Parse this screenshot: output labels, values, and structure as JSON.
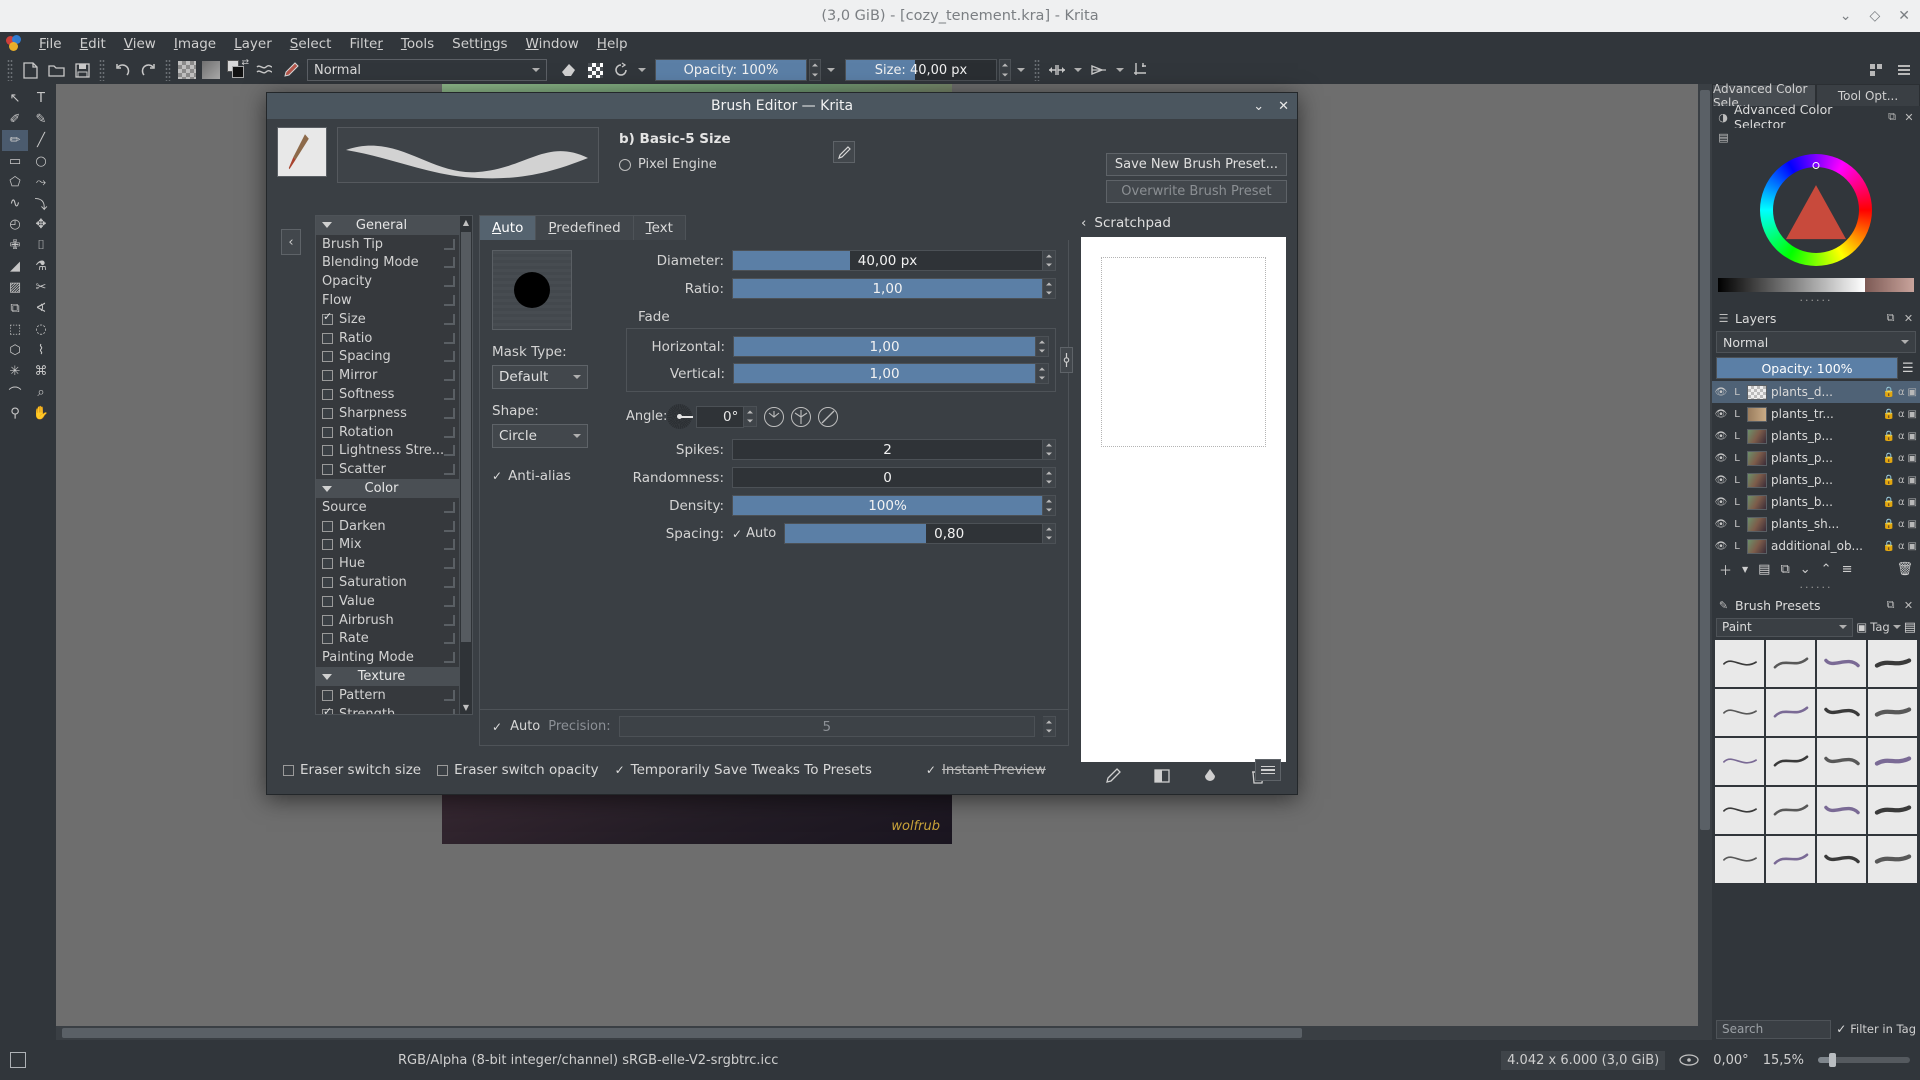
{
  "window": {
    "title": "(3,0 GiB) - [cozy_tenement.kra] - Krita",
    "minimize": "⌄",
    "maximize": "◇",
    "close": "✕"
  },
  "menubar": {
    "items": [
      {
        "label": "File",
        "accel": "F"
      },
      {
        "label": "Edit",
        "accel": "E"
      },
      {
        "label": "View",
        "accel": "V"
      },
      {
        "label": "Image",
        "accel": "I"
      },
      {
        "label": "Layer",
        "accel": "L"
      },
      {
        "label": "Select",
        "accel": "S"
      },
      {
        "label": "Filter",
        "accel": "r"
      },
      {
        "label": "Tools",
        "accel": "T"
      },
      {
        "label": "Settings",
        "accel": "n"
      },
      {
        "label": "Window",
        "accel": "W"
      },
      {
        "label": "Help",
        "accel": "H"
      }
    ]
  },
  "toolbar": {
    "blending_mode": "Normal",
    "opacity_label": "Opacity: 100%",
    "opacity_percent": 100,
    "size_label": "Size: 40,00 px",
    "size_value": "40,00 px",
    "icons": [
      "new-document-icon",
      "open-document-icon",
      "save-icon",
      "undo-icon",
      "redo-icon",
      "alpha-checker-icon",
      "gradient-swatch-icon",
      "fg-bg-color-icon",
      "brush-preset-history-icon",
      "brush-editor-icon",
      "eraser-icon",
      "preserve-alpha-icon",
      "reload-preset-icon",
      "mirror-horizontal-icon",
      "mirror-vertical-icon",
      "wrap-around-icon"
    ]
  },
  "toolbox": {
    "tools": [
      {
        "name": "shape-select-tool",
        "glyph": "↖"
      },
      {
        "name": "text-tool",
        "glyph": "T"
      },
      {
        "name": "edit-shapes-tool",
        "glyph": "✐"
      },
      {
        "name": "calligraphy-tool",
        "glyph": "✎"
      },
      {
        "name": "freehand-brush-tool",
        "glyph": "✏",
        "active": true
      },
      {
        "name": "line-tool",
        "glyph": "╱"
      },
      {
        "name": "rectangle-tool",
        "glyph": "▭"
      },
      {
        "name": "ellipse-tool",
        "glyph": "○"
      },
      {
        "name": "polygon-tool",
        "glyph": "⬠"
      },
      {
        "name": "polyline-tool",
        "glyph": "⤳"
      },
      {
        "name": "bezier-curve-tool",
        "glyph": "∿"
      },
      {
        "name": "freehand-path-tool",
        "glyph": "⤵"
      },
      {
        "name": "dynamic-brush-tool",
        "glyph": "◴"
      },
      {
        "name": "transform-tool",
        "glyph": "✥"
      },
      {
        "name": "move-tool",
        "glyph": "✙"
      },
      {
        "name": "crop-tool",
        "glyph": "⌷"
      },
      {
        "name": "fill-tool",
        "glyph": "◢"
      },
      {
        "name": "color-picker-tool",
        "glyph": "⚗"
      },
      {
        "name": "gradient-tool",
        "glyph": "▨"
      },
      {
        "name": "smart-patch-tool",
        "glyph": "✂"
      },
      {
        "name": "assistant-tool",
        "glyph": "⧉"
      },
      {
        "name": "measure-tool",
        "glyph": "∢"
      },
      {
        "name": "rect-select-tool",
        "glyph": "⬚"
      },
      {
        "name": "ellipse-select-tool",
        "glyph": "◌"
      },
      {
        "name": "polygon-select-tool",
        "glyph": "⬡"
      },
      {
        "name": "freehand-select-tool",
        "glyph": "⌇"
      },
      {
        "name": "contiguous-select-tool",
        "glyph": "✳"
      },
      {
        "name": "similar-select-tool",
        "glyph": "⌘"
      },
      {
        "name": "bezier-select-tool",
        "glyph": "⌒"
      },
      {
        "name": "magnetic-select-tool",
        "glyph": "⌕"
      },
      {
        "name": "zoom-tool",
        "glyph": "⚲"
      },
      {
        "name": "pan-tool",
        "glyph": "✋"
      }
    ]
  },
  "dialog": {
    "title": "Brush Editor — Krita",
    "collapse_glyph": "‹",
    "preset": {
      "name": "b) Basic-5 Size",
      "engine": "Pixel Engine",
      "rename_icon": "pencil-icon"
    },
    "buttons": {
      "save_new": "Save New Brush Preset...",
      "overwrite": "Overwrite Brush Preset"
    },
    "option_groups": [
      {
        "title": "General",
        "items": [
          {
            "label": "Brush Tip",
            "type": "plain"
          },
          {
            "label": "Blending Mode",
            "type": "plain"
          },
          {
            "label": "Opacity",
            "type": "plain"
          },
          {
            "label": "Flow",
            "type": "plain"
          },
          {
            "label": "Size",
            "type": "check",
            "checked": true
          },
          {
            "label": "Ratio",
            "type": "check",
            "checked": false
          },
          {
            "label": "Spacing",
            "type": "check",
            "checked": false
          },
          {
            "label": "Mirror",
            "type": "check",
            "checked": false
          },
          {
            "label": "Softness",
            "type": "check",
            "checked": false
          },
          {
            "label": "Sharpness",
            "type": "check",
            "checked": false
          },
          {
            "label": "Rotation",
            "type": "check",
            "checked": false
          },
          {
            "label": "Lightness Stre...",
            "type": "check",
            "checked": false
          },
          {
            "label": "Scatter",
            "type": "check",
            "checked": false
          }
        ]
      },
      {
        "title": "Color",
        "items": [
          {
            "label": "Source",
            "type": "plain"
          },
          {
            "label": "Darken",
            "type": "check",
            "checked": false
          },
          {
            "label": "Mix",
            "type": "check",
            "checked": false
          },
          {
            "label": "Hue",
            "type": "check",
            "checked": false
          },
          {
            "label": "Saturation",
            "type": "check",
            "checked": false
          },
          {
            "label": "Value",
            "type": "check",
            "checked": false
          },
          {
            "label": "Airbrush",
            "type": "check",
            "checked": false
          },
          {
            "label": "Rate",
            "type": "check",
            "checked": false
          },
          {
            "label": "Painting Mode",
            "type": "plain"
          }
        ]
      },
      {
        "title": "Texture",
        "items": [
          {
            "label": "Pattern",
            "type": "check",
            "checked": false
          },
          {
            "label": "Strength",
            "type": "check",
            "checked": true
          }
        ]
      }
    ],
    "tabs": [
      {
        "label": "Auto",
        "accel": "A",
        "active": true
      },
      {
        "label": "Predefined",
        "accel": "P",
        "active": false
      },
      {
        "label": "Text",
        "accel": "T",
        "active": false
      }
    ],
    "mask": {
      "mask_type_label": "Mask Type:",
      "mask_type_value": "Default",
      "shape_label": "Shape:",
      "shape_value": "Circle",
      "antialias_label": "Anti-alias",
      "antialias_checked": true
    },
    "params": {
      "diameter": {
        "label": "Diameter:",
        "value": "40,00 px",
        "fill_pct": 38
      },
      "ratio": {
        "label": "Ratio:",
        "value": "1,00",
        "fill_pct": 100
      },
      "fade_title": "Fade",
      "horizontal": {
        "label": "Horizontal:",
        "value": "1,00",
        "fill_pct": 100
      },
      "vertical": {
        "label": "Vertical:",
        "value": "1,00",
        "fill_pct": 100
      },
      "angle": {
        "label": "Angle:",
        "value": "0°"
      },
      "spikes": {
        "label": "Spikes:",
        "value": "2",
        "fill_pct": 0
      },
      "randomness": {
        "label": "Randomness:",
        "value": "0",
        "fill_pct": 0
      },
      "density": {
        "label": "Density:",
        "value": "100%",
        "fill_pct": 100
      },
      "spacing": {
        "label": "Spacing:",
        "auto_label": "Auto",
        "auto_checked": true,
        "value": "0,80",
        "fill_pct": 55
      }
    },
    "precision": {
      "auto_label": "Auto",
      "auto_checked": true,
      "label": "Precision:",
      "value": "5"
    },
    "scratchpad": {
      "title": "Scratchpad",
      "back_glyph": "‹",
      "tools": [
        "paint-icon",
        "fill-background-icon",
        "fill-gradient-icon",
        "delete-icon"
      ]
    },
    "footer": {
      "eraser_switch_size": "Eraser switch size",
      "eraser_switch_size_checked": false,
      "eraser_switch_opacity": "Eraser switch opacity",
      "eraser_switch_opacity_checked": false,
      "temp_save": "Temporarily Save Tweaks To Presets",
      "temp_save_checked": true,
      "instant_preview": "Instant Preview",
      "instant_preview_checked": true,
      "menu_icon": "hamburger-menu-icon"
    }
  },
  "dockers": {
    "tabs": [
      {
        "label": "Advanced Color Sele...",
        "active": true
      },
      {
        "label": "Tool Opt...",
        "active": false
      }
    ],
    "color_selector": {
      "title": "Advanced Color Selector",
      "settings_icon": "settings-icon",
      "float_icon": "float-icon",
      "close_icon": "close-icon"
    },
    "layers": {
      "title": "Layers",
      "blending_mode": "Normal",
      "opacity_label": "Opacity:  100%",
      "rows": [
        {
          "name": "plants_d...",
          "selected": true,
          "kind": "checker"
        },
        {
          "name": "plants_tr...",
          "selected": false,
          "kind": "strip"
        },
        {
          "name": "plants_p...",
          "selected": false,
          "kind": "art"
        },
        {
          "name": "plants_p...",
          "selected": false,
          "kind": "art"
        },
        {
          "name": "plants_p...",
          "selected": false,
          "kind": "art"
        },
        {
          "name": "plants_b...",
          "selected": false,
          "kind": "art"
        },
        {
          "name": "plants_sh...",
          "selected": false,
          "kind": "art"
        },
        {
          "name": "additional_ob...",
          "selected": false,
          "kind": "art"
        }
      ],
      "toolbar_icons": [
        "add-layer-icon",
        "layer-properties-icon",
        "duplicate-layer-icon",
        "move-down-icon",
        "move-up-icon",
        "layer-filter-icon",
        "delete-layer-icon"
      ]
    },
    "brush_presets": {
      "title": "Brush Presets",
      "tag_value": "Paint",
      "tag_button": "Tag",
      "search_placeholder": "Search",
      "filter_label": "Filter in Tag",
      "filter_checked": true,
      "rows": 5,
      "cols": 4
    }
  },
  "statusbar": {
    "selection_icon": "selection-mask-icon",
    "colorspace": "RGB/Alpha (8-bit integer/channel)  sRGB-elle-V2-srgbtrc.icc",
    "dimensions": "4.042 x 6.000 (3,0 GiB)",
    "rotation_icon": "rotation-icon",
    "rotation": "0,00°",
    "zoom": "15,5%"
  }
}
